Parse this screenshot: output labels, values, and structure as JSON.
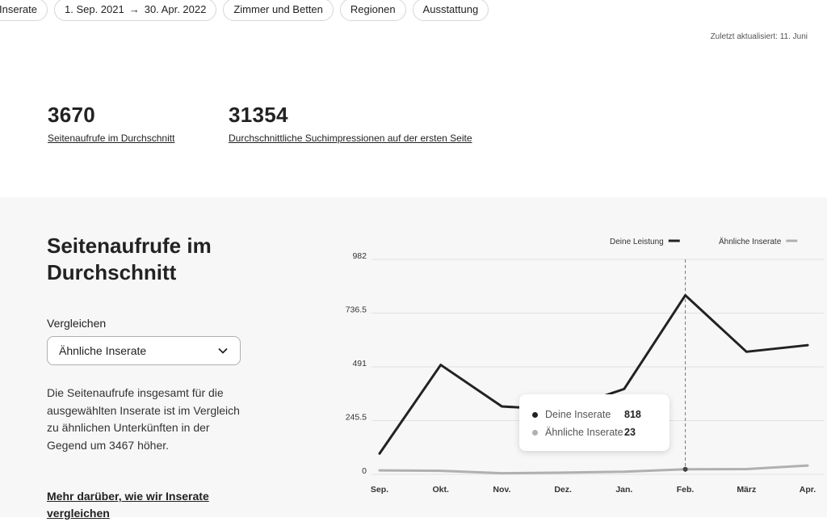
{
  "filters": {
    "chips": [
      {
        "label": "Inserate"
      },
      {
        "date_start": "1. Sep. 2021",
        "date_end": "30. Apr. 2022"
      },
      {
        "label": "Zimmer und Betten"
      },
      {
        "label": "Regionen"
      },
      {
        "label": "Ausstattung"
      }
    ]
  },
  "updated": "Zuletzt aktualisiert: 11. Juni",
  "metrics": [
    {
      "value": "3670",
      "label": "Seitenaufrufe im Durchschnitt"
    },
    {
      "value": "31354",
      "label": "Durchschnittliche Suchimpressionen auf der ersten Seite"
    }
  ],
  "section": {
    "title": "Seitenaufrufe im Durchschnitt",
    "compare_label": "Vergleichen",
    "compare_value": "Ähnliche Inserate",
    "description": "Die Seitenaufrufe insgesamt für die ausgewählten Inserate ist im Vergleich zu ähnlichen Unterkünften in der Gegend um 3467 höher.",
    "more_link": "Mehr darüber, wie wir Inserate vergleichen"
  },
  "tooltip": {
    "rows": [
      {
        "name": "Deine Inserate",
        "value": "818"
      },
      {
        "name": "Ähnliche Inserate",
        "value": "23"
      }
    ]
  },
  "colors": {
    "series_main": "#222222",
    "series_similar": "#b0b0b0"
  },
  "chart_data": {
    "type": "line",
    "categories": [
      "Sep.",
      "Okt.",
      "Nov.",
      "Dez.",
      "Jan.",
      "Feb.",
      "März",
      "Apr."
    ],
    "y_ticks": [
      "0",
      "245.5",
      "491",
      "736.5",
      "982"
    ],
    "ylim": [
      0,
      982
    ],
    "grid": true,
    "legend_position": "top-right",
    "highlight_category": "Feb.",
    "series": [
      {
        "name": "Deine Leistung",
        "values": [
          95,
          500,
          310,
          295,
          390,
          818,
          560,
          590
        ]
      },
      {
        "name": "Ähnliche Inserate",
        "values": [
          18,
          16,
          5,
          8,
          12,
          23,
          24,
          40
        ]
      }
    ]
  }
}
